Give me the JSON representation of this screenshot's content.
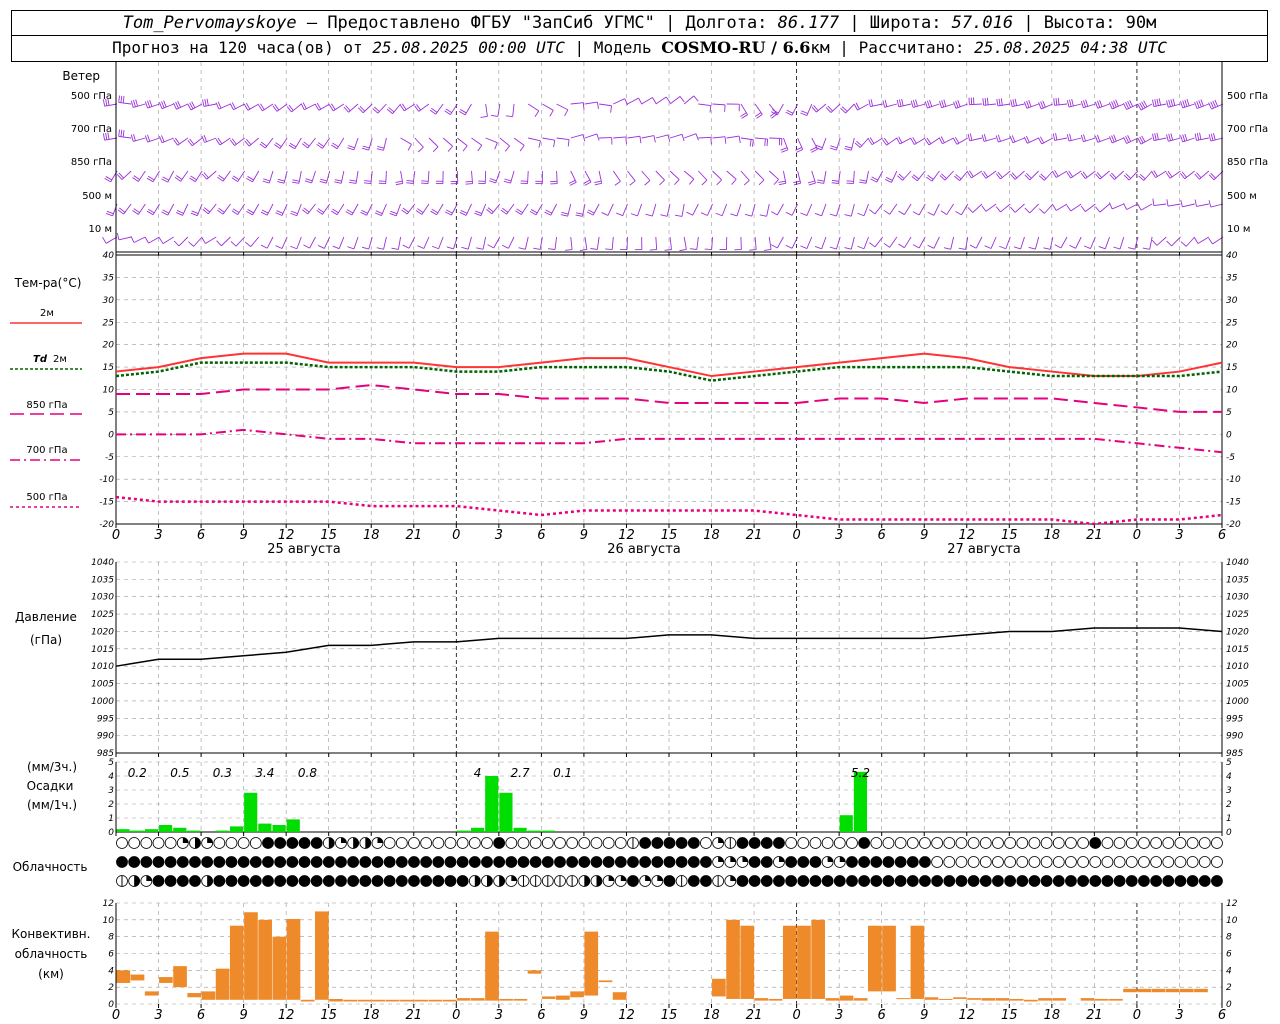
{
  "header": {
    "station": "Tom_Pervomayskoye",
    "provided": " – Предоставлено ФГБУ \"ЗапСиб УГМС\" | Долгота: ",
    "lon": "86.177",
    "lat_label": " | Широта: ",
    "lat": "57.016",
    "alt_label": " | Высота: 90м",
    "forecast_label": "Прогноз на 120 часа(ов) от ",
    "forecast_time": "25.08.2025 00:00 UTC",
    "model_label": " | Модель ",
    "model": "COSMO-RU / 6.6",
    "model_unit": "км | Рассчитано: ",
    "calc_time": "25.08.2025 04:38 UTC"
  },
  "labels": {
    "wind": "Ветер",
    "levels": [
      "500 гПа",
      "700 гПа",
      "850 гПа",
      "500 м",
      "10 м"
    ],
    "temp_title": "Тем-ра(°C)",
    "t2m": "2м",
    "td_sym": "Td",
    "td_level": "2м",
    "t850": "850 гПа",
    "t700": "700 гПа",
    "t500": "500 гПа",
    "pressure_title": "Давление",
    "pressure_unit": "(гПа)",
    "precip_unit1": "(мм/3ч.)",
    "precip_title": "Осадки",
    "precip_unit2": "(мм/1ч.)",
    "cloud_title": "Облачность",
    "conv_title1": "Конвективн.",
    "conv_title2": "облачность",
    "conv_unit": "(км)"
  },
  "days": [
    "25 августа",
    "26 августа",
    "27 августа"
  ],
  "hour_ticks": [
    "0",
    "3",
    "6",
    "9",
    "12",
    "15",
    "18",
    "21",
    "0",
    "3",
    "6",
    "9",
    "12",
    "15",
    "18",
    "21",
    "0",
    "3",
    "6",
    "9",
    "12",
    "15",
    "18",
    "21",
    "0",
    "3",
    "6"
  ],
  "colors": {
    "t2m": "#ff3333",
    "td": "#006400",
    "level": "#e6007e",
    "pressure": "#000000",
    "precip": "#00dd00",
    "conv": "#ef8a2a",
    "wind": "#9b30d9"
  },
  "chart_data": [
    {
      "type": "line",
      "title": "Тем-ра(°C)",
      "x_hours": [
        0,
        3,
        6,
        9,
        12,
        15,
        18,
        21,
        24,
        27,
        30,
        33,
        36,
        39,
        42,
        45,
        48,
        51,
        54,
        57,
        60,
        63,
        66,
        69,
        72,
        75,
        78
      ],
      "ylim": [
        -20,
        40
      ],
      "series": [
        {
          "name": "2м",
          "values": [
            14,
            15,
            17,
            18,
            18,
            16,
            16,
            16,
            15,
            15,
            16,
            17,
            17,
            15,
            13,
            14,
            15,
            16,
            17,
            18,
            17,
            15,
            14,
            13,
            13,
            14,
            16
          ]
        },
        {
          "name": "Td 2м",
          "values": [
            13,
            14,
            16,
            16,
            16,
            15,
            15,
            15,
            14,
            14,
            15,
            15,
            15,
            14,
            12,
            13,
            14,
            15,
            15,
            15,
            15,
            14,
            13,
            13,
            13,
            13,
            14
          ]
        },
        {
          "name": "850 гПа",
          "values": [
            9,
            9,
            9,
            10,
            10,
            10,
            11,
            10,
            9,
            9,
            8,
            8,
            8,
            7,
            7,
            7,
            7,
            8,
            8,
            7,
            8,
            8,
            8,
            7,
            6,
            5,
            5
          ]
        },
        {
          "name": "700 гПа",
          "values": [
            0,
            0,
            0,
            1,
            0,
            -1,
            -1,
            -2,
            -2,
            -2,
            -2,
            -2,
            -1,
            -1,
            -1,
            -1,
            -1,
            -1,
            -1,
            -1,
            -1,
            -1,
            -1,
            -1,
            -2,
            -3,
            -4
          ]
        },
        {
          "name": "500 гПа",
          "values": [
            -14,
            -15,
            -15,
            -15,
            -15,
            -15,
            -16,
            -16,
            -16,
            -17,
            -18,
            -17,
            -17,
            -17,
            -17,
            -17,
            -18,
            -19,
            -19,
            -19,
            -19,
            -19,
            -19,
            -20,
            -19,
            -19,
            -18
          ]
        }
      ]
    },
    {
      "type": "line",
      "title": "Давление",
      "ylabel": "(гПа)",
      "ylim": [
        985,
        1040
      ],
      "x_hours": [
        0,
        3,
        6,
        9,
        12,
        15,
        18,
        21,
        24,
        27,
        30,
        33,
        36,
        39,
        42,
        45,
        48,
        51,
        54,
        57,
        60,
        63,
        66,
        69,
        72,
        75,
        78
      ],
      "values": [
        1010,
        1012,
        1012,
        1013,
        1014,
        1016,
        1016,
        1017,
        1017,
        1018,
        1018,
        1018,
        1018,
        1019,
        1019,
        1018,
        1018,
        1018,
        1018,
        1018,
        1019,
        1020,
        1020,
        1021,
        1021,
        1021,
        1020
      ]
    },
    {
      "type": "bar",
      "title": "Осадки",
      "ylim": [
        0,
        5
      ],
      "x_hours": [
        0,
        1,
        2,
        3,
        4,
        5,
        6,
        7,
        8,
        9,
        10,
        11,
        12,
        13,
        14,
        15,
        24,
        25,
        26,
        27,
        28,
        29,
        30,
        51,
        52
      ],
      "values": [
        0.2,
        0.1,
        0.2,
        0.5,
        0.3,
        0.1,
        0,
        0.1,
        0.4,
        2.8,
        0.6,
        0.5,
        0.9,
        0,
        0,
        0,
        0.1,
        0.3,
        4,
        2.8,
        0.3,
        0.1,
        0.1,
        1.2,
        4.3
      ],
      "totals_3h": [
        {
          "hour": 1,
          "value": "0.2"
        },
        {
          "hour": 4,
          "value": "0.5"
        },
        {
          "hour": 7,
          "value": "0.3"
        },
        {
          "hour": 10,
          "value": "3.4"
        },
        {
          "hour": 13,
          "value": "0.8"
        },
        {
          "hour": 25,
          "value": "4"
        },
        {
          "hour": 28,
          "value": "2.7"
        },
        {
          "hour": 31,
          "value": "0.1"
        },
        {
          "hour": 52,
          "value": "5.2"
        }
      ]
    },
    {
      "type": "bar",
      "title": "Конвективн. облачность",
      "ylabel": "(км)",
      "ylim": [
        0,
        13
      ],
      "bars_km": [
        [
          0,
          2.5,
          4
        ],
        [
          1,
          2.8,
          3.5
        ],
        [
          2,
          1.0,
          1.5
        ],
        [
          3,
          2.5,
          3.2
        ],
        [
          4,
          2.0,
          4.5
        ],
        [
          5,
          0.8,
          1.3
        ],
        [
          6,
          0.5,
          1.5
        ],
        [
          7,
          0.5,
          4.2
        ],
        [
          8,
          0.5,
          9.3
        ],
        [
          9,
          0.5,
          10.9
        ],
        [
          10,
          0.5,
          10
        ],
        [
          11,
          0.5,
          8
        ],
        [
          12,
          0.5,
          10.1
        ],
        [
          13,
          0.3,
          0.5
        ],
        [
          14,
          0.5,
          11
        ],
        [
          15,
          0.3,
          0.6
        ],
        [
          16,
          0.3,
          0.5
        ],
        [
          17,
          0.3,
          0.5
        ],
        [
          18,
          0.3,
          0.5
        ],
        [
          19,
          0.3,
          0.5
        ],
        [
          20,
          0.3,
          0.5
        ],
        [
          21,
          0.3,
          0.5
        ],
        [
          22,
          0.3,
          0.5
        ],
        [
          23,
          0.3,
          0.5
        ],
        [
          24,
          0.4,
          0.7
        ],
        [
          25,
          0.4,
          0.7
        ],
        [
          26,
          0.4,
          8.6
        ],
        [
          27,
          0.4,
          0.6
        ],
        [
          28,
          0.4,
          0.6
        ],
        [
          29,
          3.6,
          4.0
        ],
        [
          30,
          0.6,
          0.9
        ],
        [
          31,
          0.5,
          1.0
        ],
        [
          32,
          0.8,
          1.5
        ],
        [
          33,
          1.0,
          8.6
        ],
        [
          34,
          2.6,
          2.8
        ],
        [
          35,
          0.5,
          1.4
        ],
        [
          42,
          0.9,
          3.0
        ],
        [
          43,
          0.6,
          10
        ],
        [
          44,
          0.6,
          9.3
        ],
        [
          45,
          0.4,
          0.7
        ],
        [
          46,
          0.4,
          0.6
        ],
        [
          47,
          0.6,
          9.3
        ],
        [
          48,
          0.6,
          9.3
        ],
        [
          49,
          0.6,
          10
        ],
        [
          50,
          0.4,
          0.7
        ],
        [
          51,
          0.4,
          1.0
        ],
        [
          52,
          0.4,
          0.7
        ],
        [
          53,
          1.5,
          9.3
        ],
        [
          54,
          1.5,
          9.3
        ],
        [
          55,
          0.6,
          0.7
        ],
        [
          56,
          0.6,
          9.3
        ],
        [
          57,
          0.5,
          0.8
        ],
        [
          58,
          0.5,
          0.6
        ],
        [
          59,
          0.6,
          0.8
        ],
        [
          60,
          0.5,
          0.7
        ],
        [
          61,
          0.4,
          0.7
        ],
        [
          62,
          0.4,
          0.7
        ],
        [
          63,
          0.4,
          0.6
        ],
        [
          64,
          0.3,
          0.5
        ],
        [
          65,
          0.4,
          0.7
        ],
        [
          66,
          0.4,
          0.7
        ],
        [
          68,
          0.4,
          0.7
        ],
        [
          69,
          0.4,
          0.6
        ],
        [
          70,
          0.4,
          0.6
        ],
        [
          71,
          1.4,
          1.8
        ],
        [
          72,
          1.4,
          1.8
        ],
        [
          73,
          1.4,
          1.8
        ],
        [
          74,
          1.4,
          1.8
        ],
        [
          75,
          1.4,
          1.8
        ],
        [
          76,
          1.4,
          1.8
        ]
      ]
    }
  ],
  "cloud_rows": [
    "oooooqhqoookfffffhqhhqooooooooofoooooooooobfffffoqbffffoooooofoooooooooooooooooofoooooooooo",
    "fffffffffffffffffffffffffffffffffffffffffffffffffqqqffqfffqqfffffffoooooooooooooooooooooooo",
    "bhqffffhfffffffffffffffffffffhhhqbbbbbhhqqfqqfbffbqffffffffffffffffffffffffffffffffffffffff"
  ]
}
